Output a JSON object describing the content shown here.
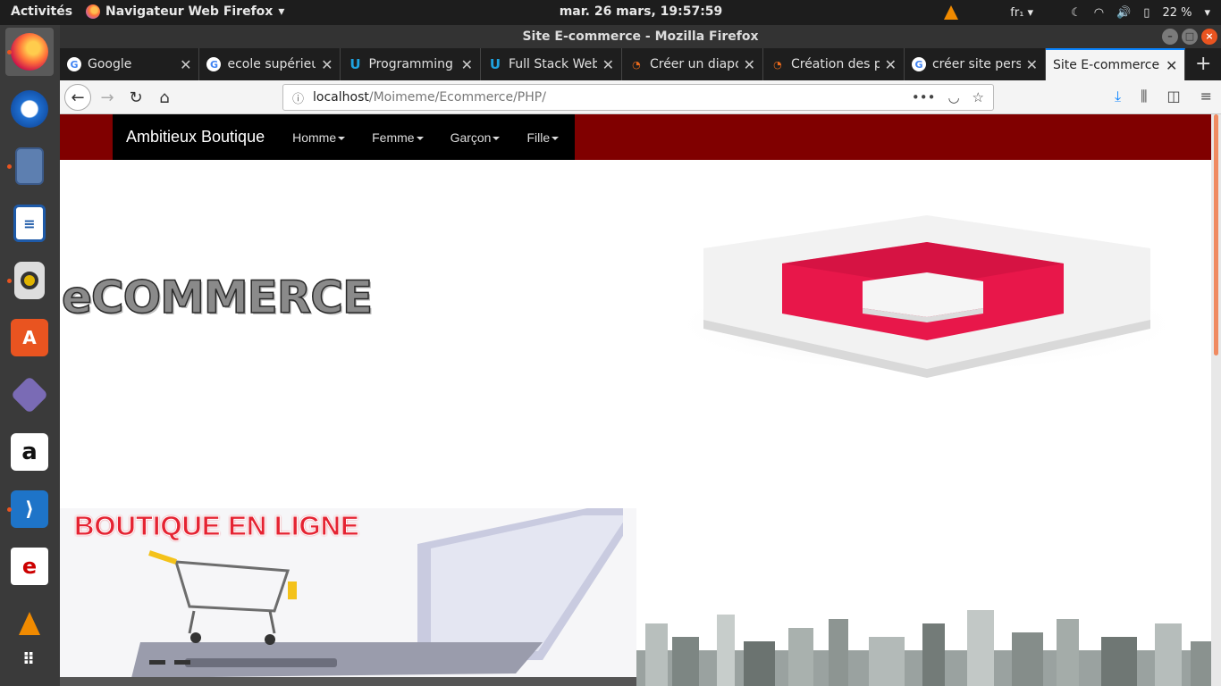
{
  "system": {
    "activities": "Activités",
    "app_menu": "Navigateur Web Firefox",
    "clock": "mar. 26 mars, 19:57:59",
    "keyboard": "fr₁",
    "battery": "22 %"
  },
  "window": {
    "title": "Site E-commerce - Mozilla Firefox"
  },
  "tabs": [
    {
      "label": "Google",
      "icon": "google-icon"
    },
    {
      "label": "ecole supérieu",
      "icon": "google-icon"
    },
    {
      "label": "Programming",
      "icon": "udemy-icon"
    },
    {
      "label": "Full Stack Web",
      "icon": "udemy-icon"
    },
    {
      "label": "Créer un diapo",
      "icon": "openclassrooms-icon"
    },
    {
      "label": "Création des p",
      "icon": "openclassrooms-icon"
    },
    {
      "label": "créer site perso",
      "icon": "google-icon"
    },
    {
      "label": "Site E-commerce",
      "icon": "",
      "active": true
    }
  ],
  "address": {
    "host": "localhost",
    "path": "/Moimeme/Ecommerce/PHP/"
  },
  "site": {
    "brand": "Ambitieux Boutique",
    "menu": [
      "Homme",
      "Femme",
      "Garçon",
      "Fille"
    ],
    "banner_text": "eCOMMERCE",
    "boutique_text": "BOUTIQUE EN LIGNE"
  },
  "colors": {
    "site_nav_bg": "#800000",
    "site_nav_inner": "#000000",
    "accent": "#e95420",
    "logo_red": "#e8174a"
  }
}
